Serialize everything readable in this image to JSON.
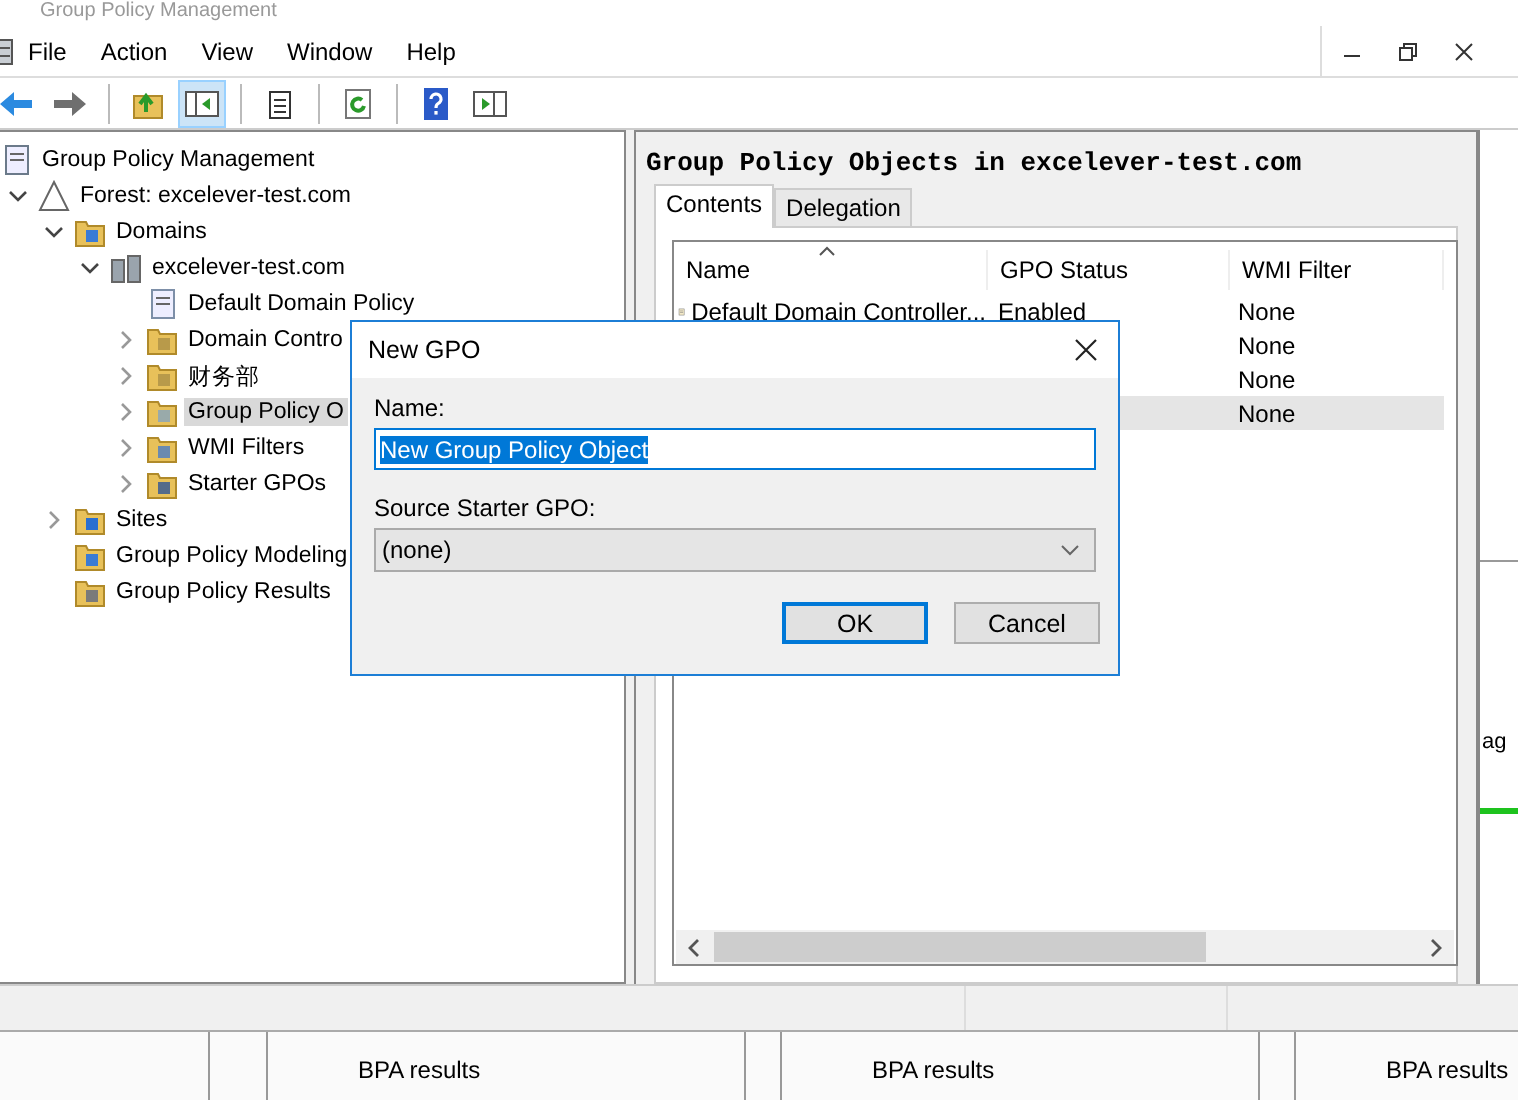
{
  "window": {
    "title": "Group Policy Management"
  },
  "menu": [
    "File",
    "Action",
    "View",
    "Window",
    "Help"
  ],
  "toolbar": [
    {
      "kind": "back",
      "pressed": false
    },
    {
      "kind": "forward",
      "pressed": false
    },
    {
      "kind": "separator"
    },
    {
      "kind": "up",
      "pressed": false
    },
    {
      "kind": "tree-toggle",
      "pressed": true
    },
    {
      "kind": "separator"
    },
    {
      "kind": "export",
      "pressed": false
    },
    {
      "kind": "separator"
    },
    {
      "kind": "refresh",
      "pressed": false
    },
    {
      "kind": "separator"
    },
    {
      "kind": "help",
      "pressed": false
    },
    {
      "kind": "panel",
      "pressed": false
    }
  ],
  "tree": [
    {
      "label": "Group Policy Management",
      "kind": "console",
      "selected": false,
      "children": [
        {
          "label": "Forest: excelever-test.com",
          "kind": "forest",
          "expanded": true,
          "selected": false,
          "children": [
            {
              "label": "Domains",
              "kind": "domains",
              "expanded": true,
              "selected": false,
              "children": [
                {
                  "label": "excelever-test.com",
                  "kind": "domain",
                  "expanded": true,
                  "selected": false,
                  "children": [
                    {
                      "label": "Default Domain Policy",
                      "kind": "gpo-link",
                      "selected": false
                    },
                    {
                      "label": "Domain Contro",
                      "kind": "ou",
                      "expanded": false,
                      "selected": false
                    },
                    {
                      "label": "财务部",
                      "kind": "ou",
                      "expanded": false,
                      "selected": false
                    },
                    {
                      "label": "Group Policy O",
                      "kind": "gpo-folder",
                      "expanded": false,
                      "selected": true
                    },
                    {
                      "label": "WMI Filters",
                      "kind": "wmi",
                      "expanded": false,
                      "selected": false
                    },
                    {
                      "label": "Starter GPOs",
                      "kind": "starter",
                      "expanded": false,
                      "selected": false
                    }
                  ]
                }
              ]
            },
            {
              "label": "Sites",
              "kind": "sites",
              "expanded": false,
              "selected": false
            },
            {
              "label": "Group Policy Modeling",
              "kind": "modeling",
              "selected": false
            },
            {
              "label": "Group Policy Results",
              "kind": "results",
              "selected": false
            }
          ]
        }
      ]
    }
  ],
  "pane": {
    "heading": "Group Policy Objects in excelever-test.com",
    "tabs": [
      {
        "label": "Contents",
        "selected": true
      },
      {
        "label": "Delegation",
        "selected": false
      }
    ],
    "columns": [
      "Name",
      "GPO Status",
      "WMI Filter"
    ],
    "rows": [
      {
        "name": "Default Domain Controller...",
        "status": "Enabled",
        "wmi_filter": "None",
        "selected": false
      },
      {
        "wmi_filter": "None",
        "selected": false
      },
      {
        "wmi_filter": "None",
        "selected": false
      },
      {
        "wmi_filter": "None",
        "selected": true
      }
    ]
  },
  "side_window": {
    "text": "ag"
  },
  "bottom_tabs": [
    "BPA results",
    "BPA results",
    "BPA results"
  ],
  "dialog": {
    "title": "New GPO",
    "name_label": "Name:",
    "name_value": "New Group Policy Object",
    "source_label": "Source Starter GPO:",
    "source_value": "(none)",
    "buttons": [
      {
        "label": "OK",
        "default": true
      },
      {
        "label": "Cancel",
        "default": false
      }
    ]
  }
}
